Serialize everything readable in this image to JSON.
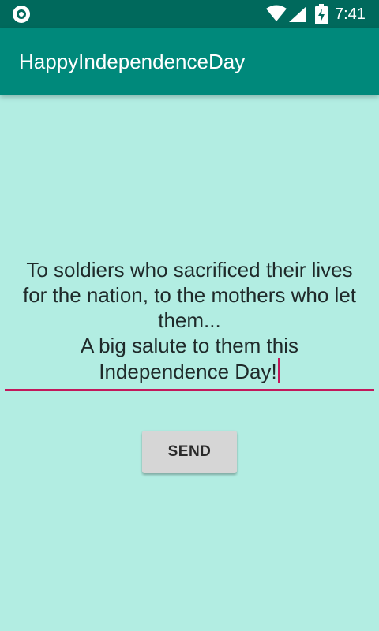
{
  "status_bar": {
    "time": "7:41",
    "icons": [
      "notification-circle-icon",
      "wifi-icon",
      "signal-icon",
      "battery-charging-icon"
    ]
  },
  "app_bar": {
    "title": "HappyIndependenceDay"
  },
  "message": {
    "lines": [
      "To soldiers who sacrificed their lives",
      "for the nation, to the mothers who let",
      "them...",
      "A big salute to them this",
      "Independence Day!"
    ]
  },
  "send_button": {
    "label": "SEND"
  },
  "colors": {
    "background": "#b2ede2",
    "status_bar": "#00695c",
    "app_bar": "#00897b",
    "accent": "#c2185b",
    "button": "#d6d6d6"
  }
}
